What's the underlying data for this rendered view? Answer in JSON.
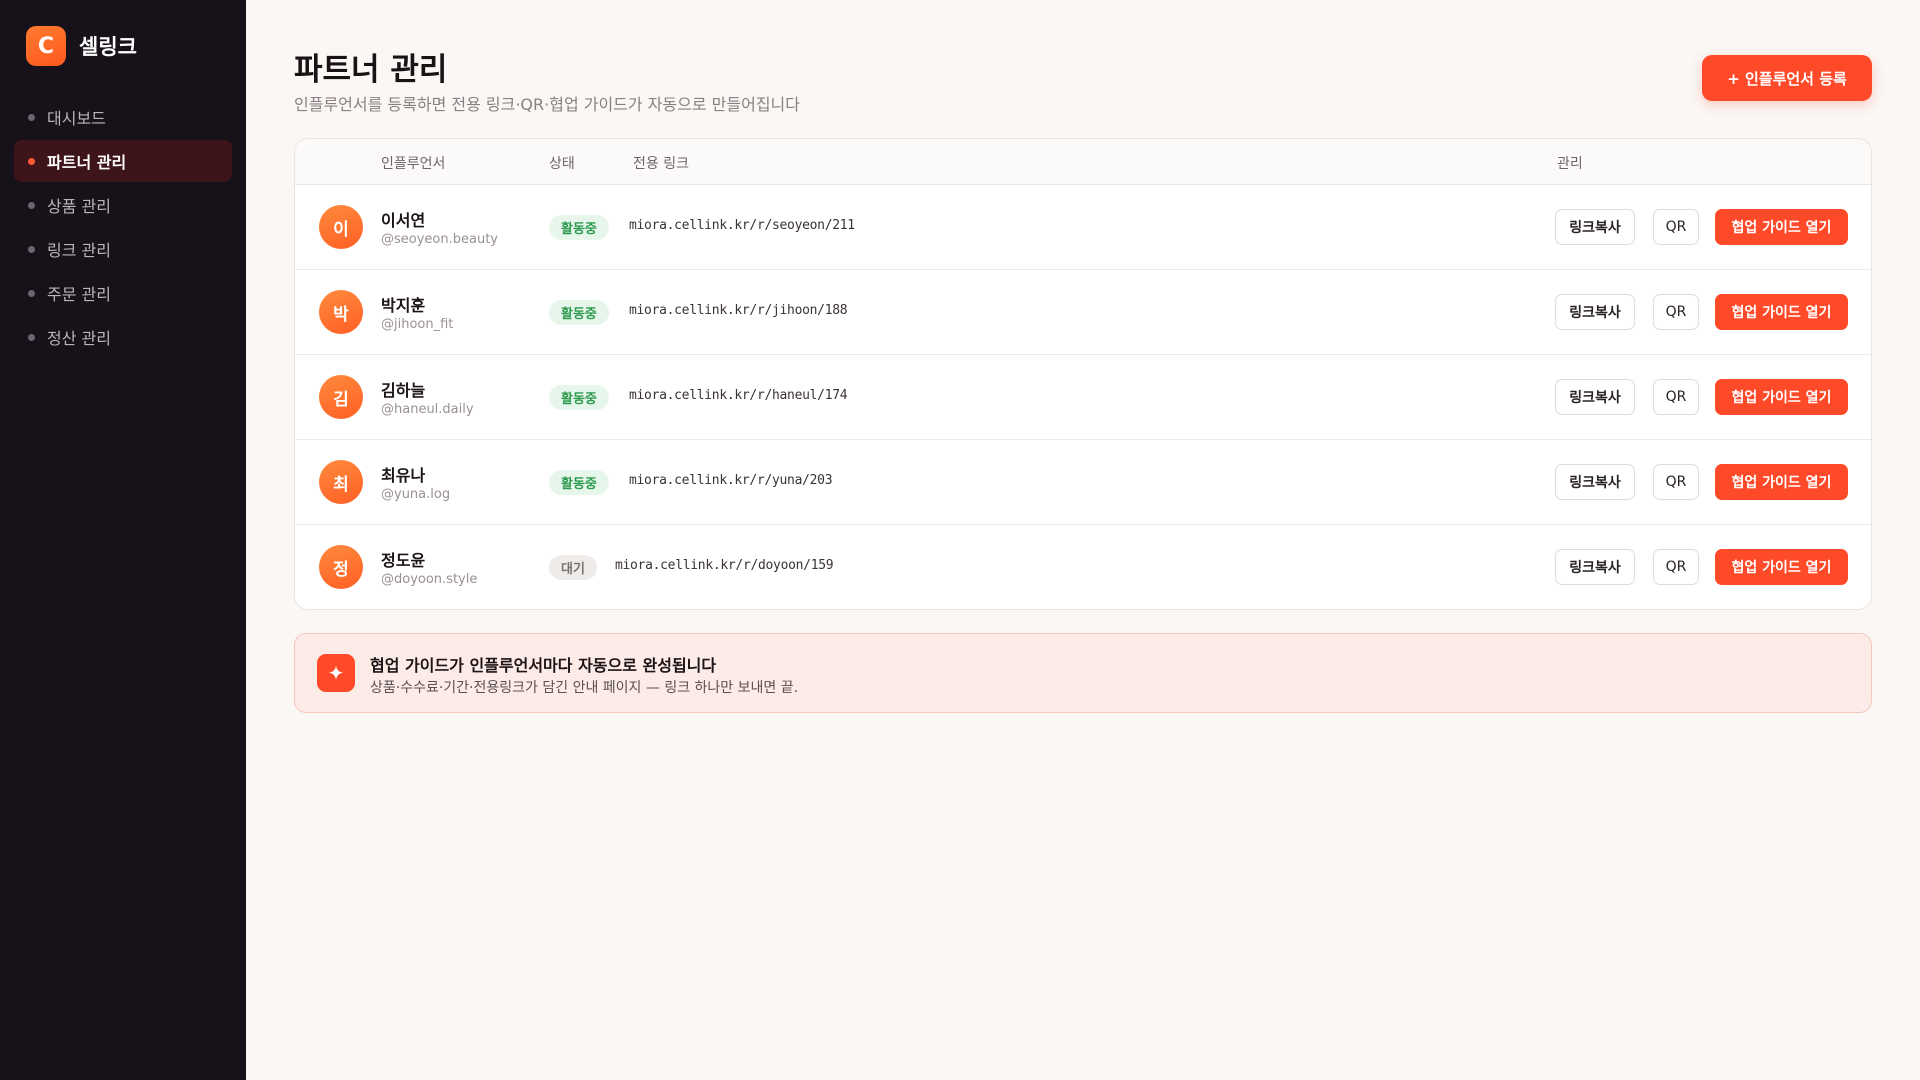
{
  "brand": {
    "logo": "C",
    "name": "셀링크"
  },
  "nav": [
    {
      "label": "대시보드",
      "active": false
    },
    {
      "label": "파트너 관리",
      "active": true
    },
    {
      "label": "상품 관리",
      "active": false
    },
    {
      "label": "링크 관리",
      "active": false
    },
    {
      "label": "주문 관리",
      "active": false
    },
    {
      "label": "정산 관리",
      "active": false
    }
  ],
  "header": {
    "title": "파트너 관리",
    "subtitle": "인플루언서를 등록하면 전용 링크·QR·협업 가이드가 자동으로 만들어집니다",
    "add_button": "+ 인플루언서 등록"
  },
  "table": {
    "columns": {
      "influencer": "인플루언서",
      "status": "상태",
      "link": "전용 링크",
      "manage": "관리"
    },
    "rows": [
      {
        "initial": "이",
        "name": "이서연",
        "handle": "@seoyeon.beauty",
        "status": "활동중",
        "status_type": "active",
        "link": "miora.cellink.kr/r/seoyeon/211"
      },
      {
        "initial": "박",
        "name": "박지훈",
        "handle": "@jihoon_fit",
        "status": "활동중",
        "status_type": "active",
        "link": "miora.cellink.kr/r/jihoon/188"
      },
      {
        "initial": "김",
        "name": "김하늘",
        "handle": "@haneul.daily",
        "status": "활동중",
        "status_type": "active",
        "link": "miora.cellink.kr/r/haneul/174"
      },
      {
        "initial": "최",
        "name": "최유나",
        "handle": "@yuna.log",
        "status": "활동중",
        "status_type": "active",
        "link": "miora.cellink.kr/r/yuna/203"
      },
      {
        "initial": "정",
        "name": "정도윤",
        "handle": "@doyoon.style",
        "status": "대기",
        "status_type": "wait",
        "link": "miora.cellink.kr/r/doyoon/159"
      }
    ],
    "actions": {
      "copy": "링크복사",
      "qr": "QR",
      "guide": "협업 가이드 열기"
    }
  },
  "banner": {
    "icon": "sparkle-icon",
    "title": "협업 가이드가 인플루언서마다 자동으로 완성됩니다",
    "desc": "상품·수수료·기간·전용링크가 담긴 안내 페이지 — 링크 하나만 보내면 끝."
  },
  "colors": {
    "accent": "#ff4a2a",
    "sidebar": "#17111a",
    "active_nav": "#3d1419",
    "status_active": "#2e9a4f"
  }
}
